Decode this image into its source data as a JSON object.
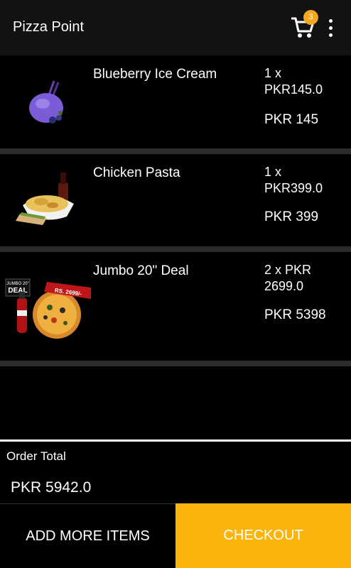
{
  "toolbar": {
    "title": "Pizza Point",
    "cart_count": "3",
    "cart_icon": "cart-icon",
    "overflow_icon": "more-vert-icon"
  },
  "cart_items": [
    {
      "name": "Blueberry Ice Cream",
      "qty_price": "1 x\nPKR145.0",
      "total": "PKR 145",
      "image": "blueberry-ice-cream-image"
    },
    {
      "name": "Chicken Pasta",
      "qty_price": "1 x\nPKR399.0",
      "total": "PKR 399",
      "image": "chicken-pasta-image"
    },
    {
      "name": "Jumbo 20\" Deal",
      "qty_price": "2 x PKR\n2699.0",
      "total": "PKR 5398",
      "image": "jumbo-deal-image"
    }
  ],
  "jumbo_image_text": {
    "badge_top": "JUMBO 20\"",
    "badge_main": "DEAL",
    "ribbon": "RS. 2699/-"
  },
  "order": {
    "total_label": "Order Total",
    "total_value": "PKR 5942.0"
  },
  "actions": {
    "add_more_label": "ADD MORE ITEMS",
    "checkout_label": "CHECKOUT"
  },
  "colors": {
    "accent": "#fbb40b",
    "badge": "#f5a623",
    "toolbar": "#121212",
    "divider": "#2b2b2b"
  }
}
